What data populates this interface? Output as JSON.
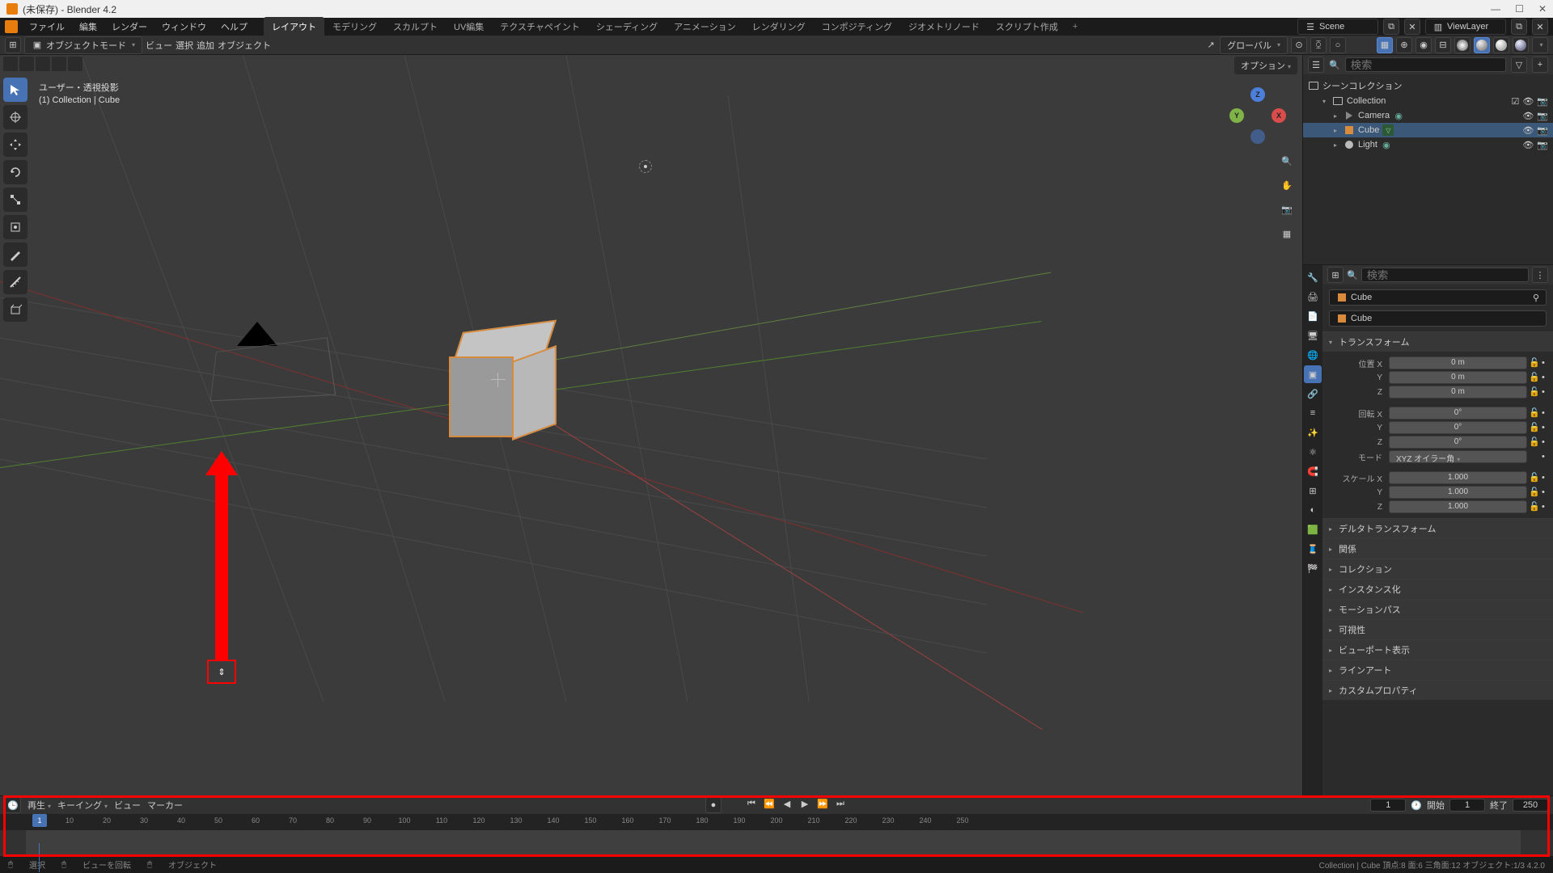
{
  "window": {
    "title": "(未保存) - Blender 4.2"
  },
  "menu": {
    "file": "ファイル",
    "edit": "編集",
    "render": "レンダー",
    "window": "ウィンドウ",
    "help": "ヘルプ"
  },
  "workspaces": {
    "items": [
      "レイアウト",
      "モデリング",
      "スカルプト",
      "UV編集",
      "テクスチャペイント",
      "シェーディング",
      "アニメーション",
      "レンダリング",
      "コンポジティング",
      "ジオメトリノード",
      "スクリプト作成"
    ],
    "active": 0
  },
  "scene_field": {
    "label": "Scene"
  },
  "viewlayer_field": {
    "label": "ViewLayer"
  },
  "header": {
    "mode": "オブジェクトモード",
    "view": "ビュー",
    "select": "選択",
    "add": "追加",
    "object": "オブジェクト",
    "orientation": "グローバル",
    "options": "オプション"
  },
  "viewport": {
    "label_line1": "ユーザー・透視投影",
    "label_line2": "(1) Collection | Cube"
  },
  "gizmo": {
    "x": "X",
    "y": "Y",
    "z": "Z"
  },
  "outliner": {
    "search_placeholder": "検索",
    "scene_collection": "シーンコレクション",
    "collection": "Collection",
    "items": [
      {
        "name": "Camera",
        "type": "camera"
      },
      {
        "name": "Cube",
        "type": "mesh",
        "selected": true
      },
      {
        "name": "Light",
        "type": "light"
      }
    ]
  },
  "properties": {
    "search_placeholder": "検索",
    "crumb_obj": "Cube",
    "crumb_data": "Cube",
    "transform": {
      "title": "トランスフォーム",
      "loc_label": "位置 X",
      "loc_x": "0 m",
      "loc_y": "0 m",
      "loc_z": "0 m",
      "rot_label": "回転 X",
      "rot_x": "0°",
      "rot_y": "0°",
      "rot_z": "0°",
      "mode_label": "モード",
      "mode_value": "XYZ オイラー角",
      "scale_label": "スケール X",
      "scale_x": "1.000",
      "scale_y": "1.000",
      "scale_z": "1.000",
      "y": "Y",
      "z": "Z"
    },
    "sections": [
      "デルタトランスフォーム",
      "関係",
      "コレクション",
      "インスタンス化",
      "モーションパス",
      "可視性",
      "ビューポート表示",
      "ラインアート",
      "カスタムプロパティ"
    ]
  },
  "timeline": {
    "playback": "再生",
    "keying": "キーイング",
    "view": "ビュー",
    "marker": "マーカー",
    "current": "1",
    "start_label": "開始",
    "start": "1",
    "end_label": "終了",
    "end": "250",
    "ticks": [
      "10",
      "20",
      "30",
      "40",
      "50",
      "60",
      "70",
      "80",
      "90",
      "100",
      "110",
      "120",
      "130",
      "140",
      "150",
      "160",
      "170",
      "180",
      "190",
      "200",
      "210",
      "220",
      "230",
      "240",
      "250"
    ]
  },
  "statusbar": {
    "select": "選択",
    "rotate": "ビューを回転",
    "object": "オブジェクト",
    "right": "Collection | Cube    頂点:8  面:6  三角面:12  オブジェクト:1/3    4.2.0"
  },
  "annotation": {
    "resize_hint": "⇕"
  }
}
